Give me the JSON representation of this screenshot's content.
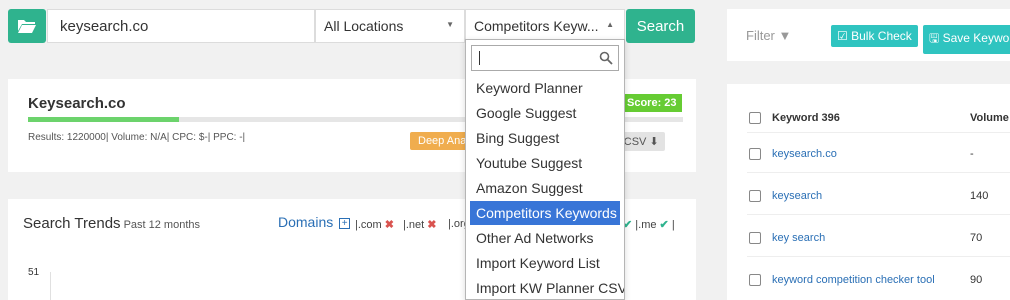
{
  "search": {
    "domain_value": "keysearch.co",
    "location_selected": "All Locations",
    "source_selected": "Competitors Keyw...",
    "search_label": "Search"
  },
  "summary": {
    "title": "Keysearch.co",
    "score_label": "Score: 23",
    "score_value": 23,
    "meta": "Results: 1220000| Volume: N/A| CPC: $-| PPC: -|",
    "deep_analysis_label": "Deep Ana",
    "export_label": "rt CSV"
  },
  "trends": {
    "title": "Search Trends",
    "subtitle": "Past 12 months",
    "domains_label": "Domains",
    "domains_plus": "+",
    "tlds": [
      {
        "label": "|.com",
        "status": "✖"
      },
      {
        "label": "|.net",
        "status": "✖"
      },
      {
        "label": "|.org",
        "status": ""
      }
    ],
    "tld_me": {
      "status": "✔",
      "label": "|.me",
      "status2": "✔",
      "end": "|"
    },
    "y_tick": "51"
  },
  "dropdown": {
    "search_value": "",
    "items": [
      "Keyword Planner",
      "Google Suggest",
      "Bing Suggest",
      "Youtube Suggest",
      "Amazon Suggest",
      "Competitors Keywords",
      "Other Ad Networks",
      "Import Keyword List",
      "Import KW Planner CSV"
    ],
    "active_index": 5
  },
  "right_panel": {
    "filter_label": "Filter",
    "bulk_check_label": "Bulk Check",
    "save_label": "Save Keywor",
    "col_keyword": "Keyword 396",
    "col_volume": "Volume",
    "rows": [
      {
        "keyword": "keysearch.co",
        "volume": "-"
      },
      {
        "keyword": "keysearch",
        "volume": "140"
      },
      {
        "keyword": "key search",
        "volume": "70"
      },
      {
        "keyword": "keyword competition checker tool",
        "volume": "90"
      }
    ]
  },
  "colors": {
    "accent_green": "#2fb38e",
    "score_green": "#66cc33",
    "highlight_blue": "#3875d7",
    "teal_button": "#2fc4c0",
    "deep_orange": "#f0ad4e",
    "x_red": "#d9534f"
  }
}
